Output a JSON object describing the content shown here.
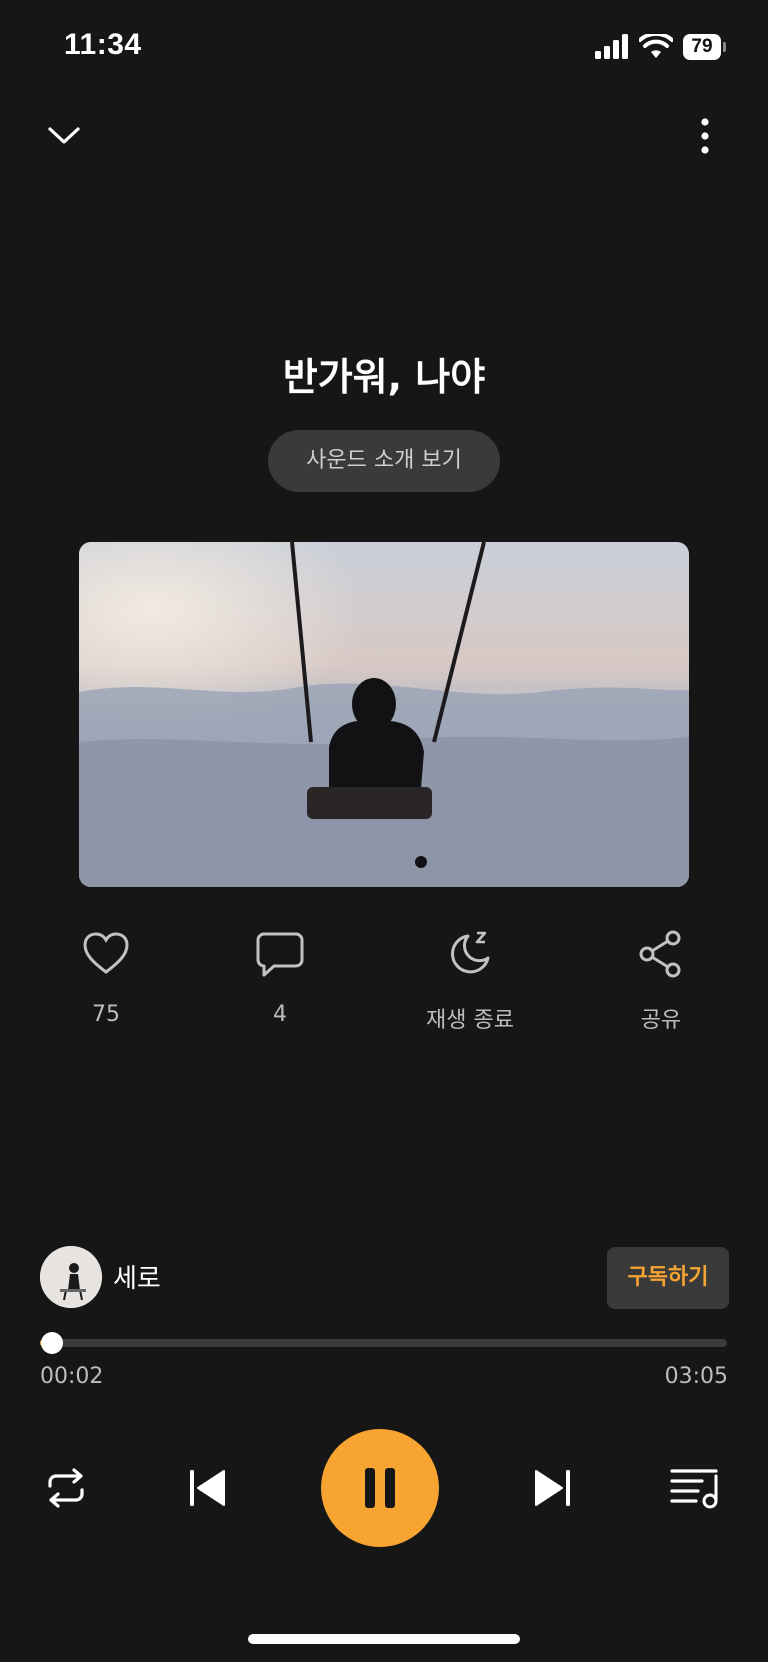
{
  "status_bar": {
    "time": "11:34",
    "battery": "79"
  },
  "track": {
    "title": "반가워, 나야",
    "intro_button": "사운드 소개 보기"
  },
  "actions": [
    {
      "id": "like",
      "icon": "heart-icon",
      "label": "75"
    },
    {
      "id": "comment",
      "icon": "comment-icon",
      "label": "4"
    },
    {
      "id": "sleep",
      "icon": "moon-sleep-icon",
      "label": "재생 종료"
    },
    {
      "id": "share",
      "icon": "share-icon",
      "label": "공유"
    }
  ],
  "creator": {
    "name": "세로",
    "subscribe_label": "구독하기"
  },
  "progress": {
    "current": "00:02",
    "total": "03:05",
    "fraction": 0.011
  },
  "controls": {
    "repeat_icon": "repeat-icon",
    "prev_icon": "skip-previous-icon",
    "play_icon": "pause-icon",
    "next_icon": "skip-next-icon",
    "playlist_icon": "playlist-icon"
  },
  "colors": {
    "accent": "#f7a432",
    "background": "#161616"
  }
}
